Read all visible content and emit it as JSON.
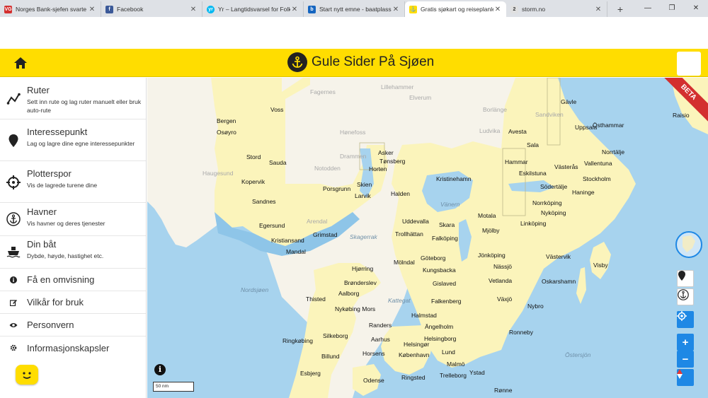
{
  "browser": {
    "tabs": [
      {
        "title": "Norges Bank-sjefen svarte om",
        "fav_color": "#d32f2f",
        "fav_text": "VG"
      },
      {
        "title": "Facebook",
        "fav_color": "#3b5998",
        "fav_text": "f"
      },
      {
        "title": "Yr – Langtidsvarsel for Folkev",
        "fav_color": "#00b8f1",
        "fav_text": "yr"
      },
      {
        "title": "Start nytt emne - baatplassen",
        "fav_color": "#1565c0",
        "fav_text": "b"
      },
      {
        "title": "Gratis sjøkart og reiseplanleg",
        "fav_color": "#ffdd00",
        "fav_text": "⚓"
      },
      {
        "title": "storm.no",
        "fav_color": "#e0e0e0",
        "fav_text": "2"
      }
    ],
    "close_glyph": "✕",
    "new_tab_glyph": "+",
    "window_controls": [
      "—",
      "❐",
      "✕"
    ]
  },
  "header": {
    "title": "Gule Sider På Sjøen",
    "home_icon": "home-icon",
    "accent_color": "#ffdd00"
  },
  "sidebar": {
    "items": [
      {
        "name": "ruter",
        "title": "Ruter",
        "desc": "Sett inn rute og lag ruter manuelt eller bruk auto-rute",
        "icon": "route-icon"
      },
      {
        "name": "interessepunkt",
        "title": "Interessepunkt",
        "desc": "Lag og lagre dine egne interessepunkter",
        "icon": "map-pin-icon"
      },
      {
        "name": "plotterspor",
        "title": "Plotterspor",
        "desc": "Vis de lagrede turene dine",
        "icon": "crosshair-icon"
      },
      {
        "name": "havner",
        "title": "Havner",
        "desc": "Vis havner og deres tjenester",
        "icon": "anchor-icon"
      },
      {
        "name": "din-bat",
        "title": "Din båt",
        "desc": "Dybde, høyde, hastighet etc.",
        "icon": "boat-icon"
      }
    ],
    "links": [
      {
        "name": "omvisning",
        "title": "Få en omvisning",
        "icon": "info-icon"
      },
      {
        "name": "vilkar",
        "title": "Vilkår for bruk",
        "icon": "edit-icon"
      },
      {
        "name": "personvern",
        "title": "Personvern",
        "icon": "eye-icon"
      },
      {
        "name": "informasjonskapsler",
        "title": "Informasjonskapsler",
        "icon": "gear-icon"
      }
    ]
  },
  "map": {
    "beta_label": "BETA",
    "info_glyph": "i",
    "scale_label": "50 nm",
    "zoom_in": "+",
    "zoom_out": "−",
    "places": [
      "Bergen",
      "Voss",
      "Osøyro",
      "Stord",
      "Sauda",
      "Haugesund",
      "Kopervik",
      "Sandnes",
      "Egersund",
      "Kristiansand",
      "Mandal",
      "Grimstad",
      "Arendal",
      "Porsgrunn",
      "Skien",
      "Larvik",
      "Horten",
      "Tønsberg",
      "Asker",
      "Halden",
      "Uddevalla",
      "Trollhättan",
      "Falköping",
      "Skara",
      "Kristinehamn",
      "Motala",
      "Mjölby",
      "Linköping",
      "Norrköping",
      "Nyköping",
      "Södertälje",
      "Stockholm",
      "Haninge",
      "Västerås",
      "Eskilstuna",
      "Sala",
      "Avesta",
      "Gävle",
      "Uppsala",
      "Norrtälje",
      "Vallentuna",
      "Östhammar",
      "Raisio",
      "Hjørring",
      "Brønderslev",
      "Aalborg",
      "Thisted",
      "Nykøbing Mors",
      "Randers",
      "Aarhus",
      "Silkeborg",
      "Ringkøbing",
      "Billund",
      "Horsens",
      "Esbjerg",
      "Odense",
      "Göteborg",
      "Kungsbacka",
      "Mölndal",
      "Gislaved",
      "Jönköping",
      "Nässjö",
      "Vetlanda",
      "Västervik",
      "Visby",
      "Oskarshamn",
      "Växjö",
      "Nybro",
      "Halmstad",
      "Falkenberg",
      "Ängelholm",
      "Helsingborg",
      "Helsingør",
      "København",
      "Lund",
      "Malmö",
      "Trelleborg",
      "Ystad",
      "Ringsted",
      "Ronneby",
      "Rønne",
      "Sandviken",
      "Borlänge",
      "Ludvika",
      "Lillehammer",
      "Elverum",
      "Fagernes",
      "Hønefoss",
      "Drammen",
      "Notodden",
      "Hammar",
      "Skagerrak",
      "Kattegat",
      "Vänern",
      "Östersjön",
      "Nordsjøen"
    ]
  }
}
